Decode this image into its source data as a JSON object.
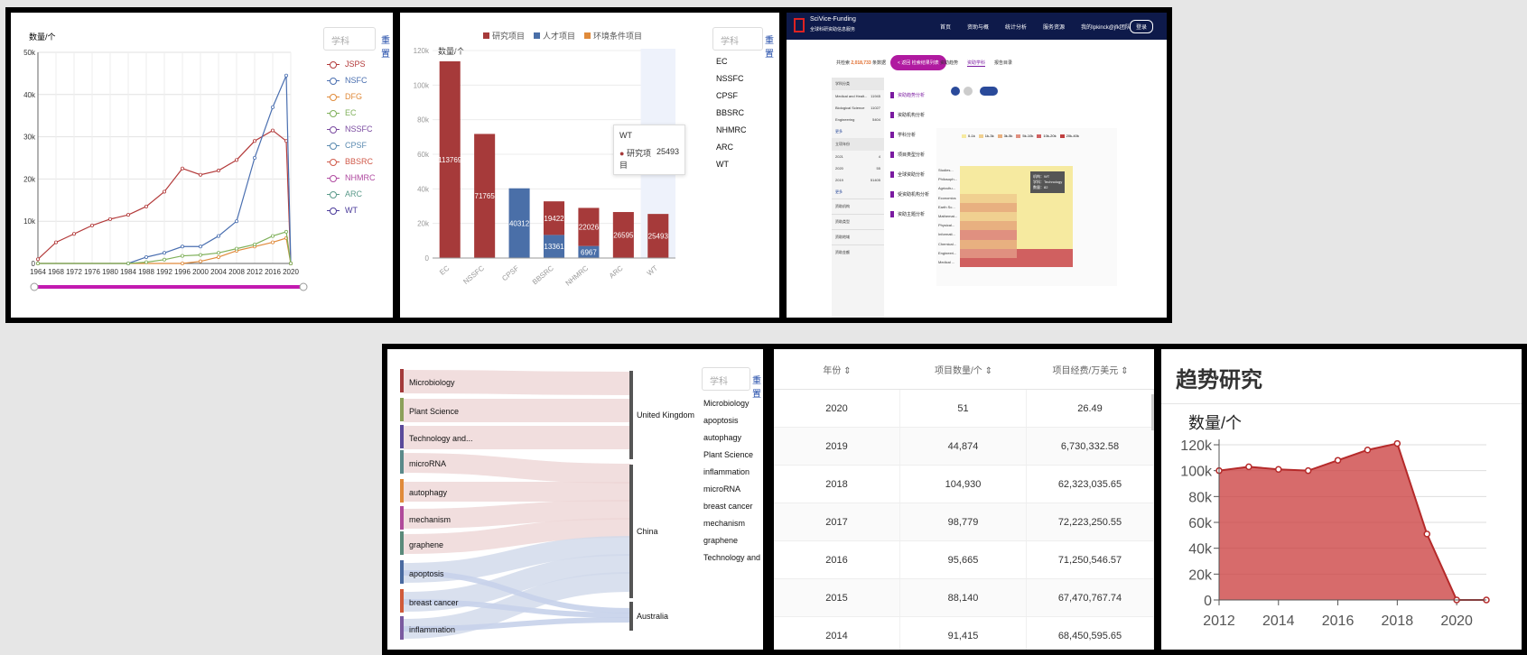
{
  "panel1": {
    "ylabel": "数量/个",
    "search_placeholder": "学科",
    "reset_label": "重置",
    "yticks": [
      "0",
      "10k",
      "20k",
      "30k",
      "40k",
      "50k"
    ],
    "xticks": [
      "1964",
      "1968",
      "1972",
      "1976",
      "1980",
      "1984",
      "1988",
      "1992",
      "1996",
      "2000",
      "2004",
      "2008",
      "2012",
      "2016",
      "2020"
    ],
    "legend": [
      {
        "name": "JSPS",
        "color": "#b33a3a"
      },
      {
        "name": "NSFC",
        "color": "#4a6fb0"
      },
      {
        "name": "DFG",
        "color": "#e08a3a"
      },
      {
        "name": "EC",
        "color": "#7fb05a"
      },
      {
        "name": "NSSFC",
        "color": "#7a4aa0"
      },
      {
        "name": "CPSF",
        "color": "#5a8ab0"
      },
      {
        "name": "BBSRC",
        "color": "#d05a4a"
      },
      {
        "name": "NHMRC",
        "color": "#b04aa0"
      },
      {
        "name": "ARC",
        "color": "#5a9a8a"
      },
      {
        "name": "WT",
        "color": "#4a3a9a"
      }
    ],
    "chart_data": {
      "type": "line",
      "ylim": [
        0,
        50000
      ],
      "series": [
        {
          "name": "JSPS",
          "x": [
            1964,
            1968,
            1972,
            1976,
            1980,
            1984,
            1988,
            1992,
            1996,
            2000,
            2004,
            2008,
            2012,
            2016,
            2019,
            2020
          ],
          "values": [
            1000,
            5000,
            7000,
            9000,
            10500,
            11500,
            13500,
            17000,
            22500,
            21000,
            22000,
            24500,
            29000,
            31500,
            29000,
            0
          ]
        },
        {
          "name": "NSFC",
          "x": [
            1964,
            1984,
            1988,
            1992,
            1996,
            2000,
            2004,
            2008,
            2012,
            2016,
            2019,
            2020
          ],
          "values": [
            0,
            0,
            1500,
            2500,
            4000,
            4000,
            6500,
            10000,
            25000,
            37000,
            44500,
            0
          ]
        },
        {
          "name": "DFG",
          "x": [
            1964,
            1996,
            2000,
            2004,
            2008,
            2012,
            2016,
            2019,
            2020
          ],
          "values": [
            0,
            0,
            500,
            1500,
            3000,
            4000,
            5000,
            6000,
            0
          ]
        },
        {
          "name": "EC",
          "x": [
            1964,
            1984,
            1988,
            1992,
            1996,
            2000,
            2004,
            2008,
            2012,
            2016,
            2019,
            2020
          ],
          "values": [
            0,
            0,
            300,
            900,
            1800,
            2000,
            2500,
            3500,
            4500,
            6500,
            7500,
            0
          ]
        }
      ]
    }
  },
  "panel2": {
    "legend": [
      {
        "name": "研究项目",
        "color": "#a63a3a"
      },
      {
        "name": "人才项目",
        "color": "#4a6fa8"
      },
      {
        "name": "环境条件项目",
        "color": "#e08a3a"
      }
    ],
    "ylabel": "数量/个",
    "yticks": [
      "0",
      "20k",
      "40k",
      "60k",
      "80k",
      "100k",
      "120k"
    ],
    "search_placeholder": "学科",
    "reset_label": "重置",
    "filters": [
      "EC",
      "NSSFC",
      "CPSF",
      "BBSRC",
      "NHMRC",
      "ARC",
      "WT"
    ],
    "remove_label": "x",
    "tooltip": {
      "title": "WT",
      "series": "研究项目",
      "value": "25493"
    },
    "chart_data": {
      "type": "bar",
      "categories": [
        "EC",
        "NSSFC",
        "CPSF",
        "BBSRC",
        "NHMRC",
        "ARC",
        "WT"
      ],
      "ylim": [
        0,
        120000
      ],
      "series": [
        {
          "name": "研究项目",
          "values": [
            113769,
            71765,
            0,
            19422,
            22026,
            26595,
            25493
          ]
        },
        {
          "name": "人才项目",
          "values": [
            0,
            0,
            40312,
            13361,
            6967,
            0,
            0
          ]
        }
      ],
      "data_labels": [
        "113769",
        "71765",
        "40312",
        "19422",
        "13361",
        "22026",
        "6967",
        "26595",
        "25493"
      ]
    }
  },
  "panel3": {
    "brand": "SciVice-Funding",
    "brand_sub": "全球科研资助信息服务",
    "nav": [
      "首页",
      "资助与概",
      "统计分析",
      "服务资源",
      "我的Ipkinck@jfk团队"
    ],
    "login": "登录",
    "result_prefix": "共检索",
    "result_count": "2,018,733",
    "result_suffix": "条数据",
    "back_btn": "< 返回 检索结果列表",
    "tabs": [
      "资助趋势",
      "资助学科",
      "报告目录"
    ],
    "left_groups": [
      "学科分类",
      "立项年份",
      "资助机构",
      "资助类型",
      "资助地域",
      "资助金额"
    ],
    "left_items": [
      {
        "name": "Medical and Healt...",
        "count": "11945"
      },
      {
        "name": "Biological Science",
        "count": "11027"
      },
      {
        "name": "Engineering",
        "count": "5404"
      }
    ],
    "more": "更多",
    "years": [
      {
        "name": "2021",
        "count": "4"
      },
      {
        "name": "2020",
        "count": "55"
      },
      {
        "name": "2019",
        "count": "51405"
      }
    ],
    "menu": [
      "资助趋势分析",
      "资助机构分析",
      "学科分析",
      "项目类型分析",
      "全球资助分析",
      "受资助机构分析",
      "资助主题分析"
    ],
    "legend": [
      "0-1k",
      "1k-3k",
      "3k-5k",
      "5k-10k",
      "10k-20k",
      "20k-40k"
    ],
    "tooltip": {
      "l1": "机构：WT",
      "l2": "学科：Technology",
      "l3": "数量：82"
    },
    "heat_rows": [
      "Studies...",
      "Philosoph...",
      "Agricultu...",
      "Economics",
      "Earth Sc...",
      "Mathemat...",
      "Physical...",
      "Informati...",
      "Chemical...",
      "Engineeri...",
      "Medical ..."
    ]
  },
  "panel4": {
    "search_placeholder": "学科",
    "reset_label": "重置",
    "sources": [
      {
        "name": "Microbiology",
        "color": "#a33a3a"
      },
      {
        "name": "Plant Science",
        "color": "#8ba05a"
      },
      {
        "name": "Technology and...",
        "color": "#5a4a9a"
      },
      {
        "name": "microRNA",
        "color": "#5a8a8a"
      },
      {
        "name": "autophagy",
        "color": "#e08a3a"
      },
      {
        "name": "mechanism",
        "color": "#b04a9a"
      },
      {
        "name": "graphene",
        "color": "#5a8a7a"
      },
      {
        "name": "apoptosis",
        "color": "#4a6aa0"
      },
      {
        "name": "breast cancer",
        "color": "#d05a3a"
      },
      {
        "name": "inflammation",
        "color": "#7a5aa0"
      }
    ],
    "targets": [
      "United Kingdom",
      "China",
      "Australia"
    ],
    "filters": [
      "Microbiology",
      "apoptosis",
      "autophagy",
      "Plant Science",
      "inflammation",
      "microRNA",
      "breast cancer",
      "mechanism",
      "graphene",
      "Technology and Me..."
    ],
    "remove_label": "x"
  },
  "panel5": {
    "headers": [
      "年份 ⇕",
      "项目数量/个 ⇕",
      "项目经费/万美元 ⇕"
    ],
    "rows": [
      [
        "2020",
        "51",
        "26.49"
      ],
      [
        "2019",
        "44,874",
        "6,730,332.58"
      ],
      [
        "2018",
        "104,930",
        "62,323,035.65"
      ],
      [
        "2017",
        "98,779",
        "72,223,250.55"
      ],
      [
        "2016",
        "95,665",
        "71,250,546.57"
      ],
      [
        "2015",
        "88,140",
        "67,470,767.74"
      ],
      [
        "2014",
        "91,415",
        "68,450,595.65"
      ]
    ]
  },
  "panel6": {
    "title": "趋势研究",
    "ylabel": "数量/个",
    "yticks": [
      "0",
      "20k",
      "40k",
      "60k",
      "80k",
      "100k",
      "120k"
    ],
    "xticks": [
      "2012",
      "2014",
      "2016",
      "2018",
      "2020"
    ],
    "chart_data": {
      "type": "area",
      "x": [
        2012,
        2013,
        2014,
        2015,
        2016,
        2017,
        2018,
        2019,
        2020,
        2021
      ],
      "values": [
        100000,
        103000,
        101000,
        100000,
        108000,
        116000,
        121000,
        51000,
        0,
        0
      ],
      "ylim": [
        0,
        120000
      ],
      "color": "#c9393a"
    }
  }
}
